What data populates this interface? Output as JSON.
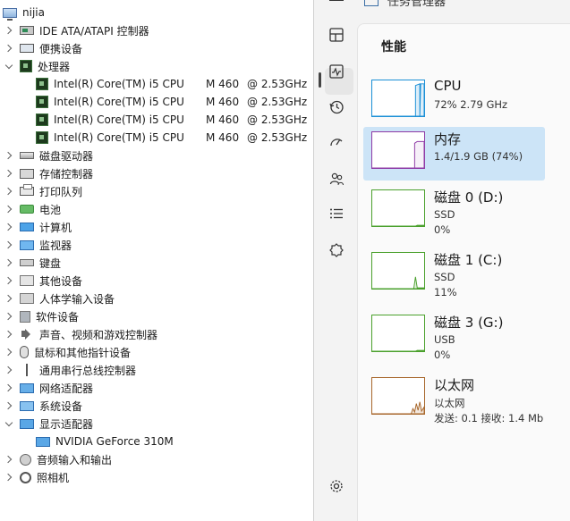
{
  "device_manager": {
    "root": "nijia",
    "items": [
      {
        "label": "IDE ATA/ATAPI 控制器",
        "icon": "ide-controller-icon",
        "expanded": false
      },
      {
        "label": "便携设备",
        "icon": "portable-device-icon",
        "expanded": false
      },
      {
        "label": "处理器",
        "icon": "processor-icon",
        "expanded": true
      },
      {
        "label": "磁盘驱动器",
        "icon": "disk-drive-icon",
        "expanded": false
      },
      {
        "label": "存储控制器",
        "icon": "storage-controller-icon",
        "expanded": false
      },
      {
        "label": "打印队列",
        "icon": "printer-icon",
        "expanded": false
      },
      {
        "label": "电池",
        "icon": "battery-icon",
        "expanded": false
      },
      {
        "label": "计算机",
        "icon": "computer-icon",
        "expanded": false
      },
      {
        "label": "监视器",
        "icon": "monitor-icon",
        "expanded": false
      },
      {
        "label": "键盘",
        "icon": "keyboard-icon",
        "expanded": false
      },
      {
        "label": "其他设备",
        "icon": "other-devices-icon",
        "expanded": false
      },
      {
        "label": "人体学输入设备",
        "icon": "hid-icon",
        "expanded": false
      },
      {
        "label": "软件设备",
        "icon": "software-device-icon",
        "expanded": false
      },
      {
        "label": "声音、视频和游戏控制器",
        "icon": "sound-icon",
        "expanded": false
      },
      {
        "label": "鼠标和其他指针设备",
        "icon": "mouse-icon",
        "expanded": false
      },
      {
        "label": "通用串行总线控制器",
        "icon": "usb-icon",
        "expanded": false
      },
      {
        "label": "网络适配器",
        "icon": "network-adapter-icon",
        "expanded": false
      },
      {
        "label": "系统设备",
        "icon": "system-device-icon",
        "expanded": false
      },
      {
        "label": "显示适配器",
        "icon": "display-adapter-icon",
        "expanded": true
      },
      {
        "label": "音频输入和输出",
        "icon": "audio-io-icon",
        "expanded": false
      },
      {
        "label": "照相机",
        "icon": "camera-icon",
        "expanded": false
      }
    ],
    "processors": [
      {
        "name": "Intel(R) Core(TM) i5 CPU",
        "model": "M 460",
        "speed": "@ 2.53GHz"
      },
      {
        "name": "Intel(R) Core(TM) i5 CPU",
        "model": "M 460",
        "speed": "@ 2.53GHz"
      },
      {
        "name": "Intel(R) Core(TM) i5 CPU",
        "model": "M 460",
        "speed": "@ 2.53GHz"
      },
      {
        "name": "Intel(R) Core(TM) i5 CPU",
        "model": "M 460",
        "speed": "@ 2.53GHz"
      }
    ],
    "display_adapters": [
      {
        "name": "NVIDIA GeForce 310M"
      }
    ]
  },
  "task_manager": {
    "app_title": "任务管理器",
    "section_title": "性能",
    "nav": [
      {
        "name": "processes",
        "icon": "processes-icon"
      },
      {
        "name": "performance",
        "icon": "performance-icon",
        "active": true
      },
      {
        "name": "app-history",
        "icon": "history-icon"
      },
      {
        "name": "startup",
        "icon": "startup-icon"
      },
      {
        "name": "users",
        "icon": "users-icon"
      },
      {
        "name": "details",
        "icon": "details-icon"
      },
      {
        "name": "services",
        "icon": "services-icon"
      },
      {
        "name": "settings",
        "icon": "settings-icon"
      }
    ],
    "items": [
      {
        "name": "CPU",
        "sub1": "72% 2.79 GHz",
        "sub2": "",
        "color": "#1a8fd6",
        "usage": 0.72,
        "selected": false
      },
      {
        "name": "内存",
        "sub1": "1.4/1.9 GB (74%)",
        "sub2": "",
        "color": "#8e3aa6",
        "usage": 0.74,
        "selected": true
      },
      {
        "name": "磁盘 0 (D:)",
        "sub1": "SSD",
        "sub2": "0%",
        "color": "#4aa02c",
        "usage": 0.0,
        "selected": false
      },
      {
        "name": "磁盘 1 (C:)",
        "sub1": "SSD",
        "sub2": "11%",
        "color": "#4aa02c",
        "usage": 0.11,
        "selected": false
      },
      {
        "name": "磁盘 3 (G:)",
        "sub1": "USB",
        "sub2": "0%",
        "color": "#4aa02c",
        "usage": 0.0,
        "selected": false
      },
      {
        "name": "以太网",
        "sub1": "以太网",
        "sub2": "发送: 0.1  接收: 1.4 Mb",
        "color": "#a7662a",
        "usage": 0.2,
        "selected": false
      }
    ]
  }
}
